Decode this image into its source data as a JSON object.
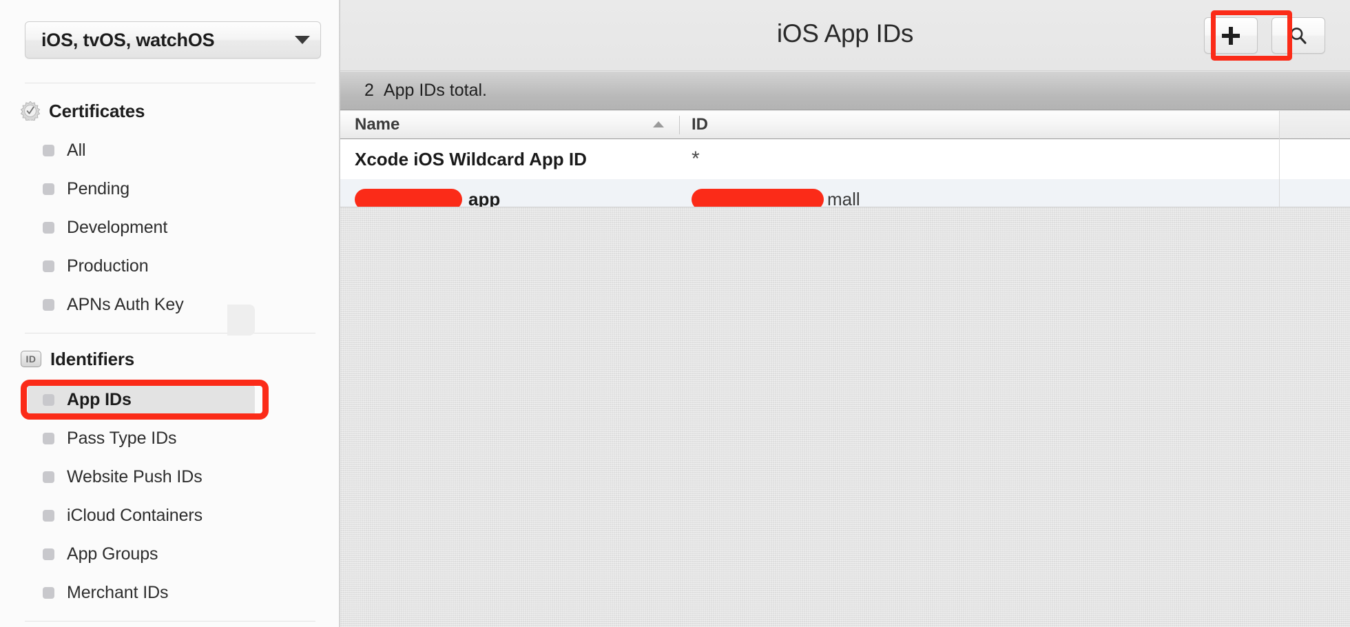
{
  "sidebar": {
    "platform_select": {
      "value": "iOS, tvOS, watchOS",
      "arrow_icon": "chevron-down-icon"
    },
    "sections": [
      {
        "id": "certificates",
        "title": "Certificates",
        "icon": "certificate-seal-icon",
        "items": [
          {
            "label": "All",
            "selected": false
          },
          {
            "label": "Pending",
            "selected": false
          },
          {
            "label": "Development",
            "selected": false
          },
          {
            "label": "Production",
            "selected": false
          },
          {
            "label": "APNs Auth Key",
            "selected": false
          }
        ]
      },
      {
        "id": "identifiers",
        "title": "Identifiers",
        "icon": "id-badge-icon",
        "items": [
          {
            "label": "App IDs",
            "selected": true
          },
          {
            "label": "Pass Type IDs",
            "selected": false
          },
          {
            "label": "Website Push IDs",
            "selected": false
          },
          {
            "label": "iCloud Containers",
            "selected": false
          },
          {
            "label": "App Groups",
            "selected": false
          },
          {
            "label": "Merchant IDs",
            "selected": false
          }
        ]
      }
    ]
  },
  "header": {
    "title": "iOS App IDs",
    "add_button": {
      "label": "+",
      "icon": "plus-icon"
    },
    "search_button": {
      "icon": "search-icon"
    }
  },
  "status_bar": {
    "count": "2",
    "text": "App IDs total."
  },
  "table": {
    "columns": [
      {
        "key": "name",
        "label": "Name",
        "sort": "ascending",
        "sort_icon": "sort-ascending-icon"
      },
      {
        "key": "id",
        "label": "ID",
        "sort": "none"
      }
    ],
    "rows": [
      {
        "name": "Xcode iOS Wildcard App ID",
        "name_redacted": false,
        "id": "*",
        "id_redacted": false
      },
      {
        "name": "app",
        "name_redacted": true,
        "id": "mall",
        "id_redacted": true
      }
    ]
  },
  "annotations": {
    "color": "#fb2b18",
    "targets": [
      "add-button",
      "sidebar-item-app-ids"
    ]
  }
}
